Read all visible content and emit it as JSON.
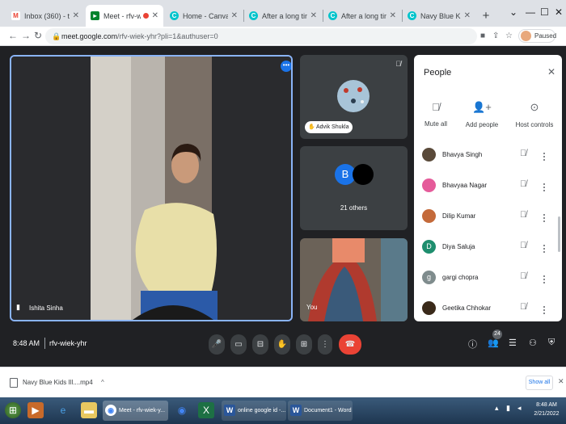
{
  "browser": {
    "tabs": [
      {
        "title": "Inbox (360) - tarannum",
        "favicon": "gmail-icon",
        "active": false
      },
      {
        "title": "Meet - rfv-wiek-yhr",
        "favicon": "meet-icon",
        "active": true,
        "recording": true
      },
      {
        "title": "Home - Canva",
        "favicon": "canva-icon",
        "active": false
      },
      {
        "title": "After a long time our st",
        "favicon": "canva-icon",
        "active": false
      },
      {
        "title": "After a long time our st",
        "favicon": "canva-icon",
        "active": false
      },
      {
        "title": "Navy Blue Kids Illustrat",
        "favicon": "canva-icon",
        "active": false
      }
    ],
    "new_tab_glyph": "+",
    "window": {
      "minimize": "⌄",
      "restore": "—",
      "maximize": "☐",
      "close": "✕"
    },
    "url_host": "meet.google.com",
    "url_path": "/rfv-wiek-yhr?pli=1&authuser=0",
    "profile_label": "Paused"
  },
  "meet": {
    "main_tile": {
      "name": "Ishita Sinha"
    },
    "tiles": [
      {
        "name": "Advik Shukla"
      },
      {
        "avatar_letter": "B",
        "others_label": "21 others"
      },
      {
        "name": "You"
      }
    ],
    "time": "8:48 AM",
    "meeting_code": "rfv-wiek-yhr",
    "participants_count": "24",
    "colors": {
      "accent": "#8ab4f8",
      "end_call": "#ea4335",
      "panel_bg": "#ffffff"
    }
  },
  "people_panel": {
    "title": "People",
    "actions": [
      {
        "label": "Mute all",
        "icon": "mic-off-icon"
      },
      {
        "label": "Add people",
        "icon": "add-person-icon"
      },
      {
        "label": "Host controls",
        "icon": "toggle-icon"
      }
    ],
    "participants": [
      {
        "name": "Bhavya Singh",
        "avatar": "",
        "color": "#5a4a3a"
      },
      {
        "name": "Bhavyaa Nagar",
        "avatar": "",
        "color": "#e55b9a"
      },
      {
        "name": "Dilip Kumar",
        "avatar": "",
        "color": "#c46a3a"
      },
      {
        "name": "Diya Saluja",
        "avatar": "D",
        "color": "#1e8e6e"
      },
      {
        "name": "gargi chopra",
        "avatar": "g",
        "color": "#7f8c8d"
      },
      {
        "name": "Geetika Chhokar",
        "avatar": "",
        "color": "#3a2a1a"
      }
    ]
  },
  "downloads": {
    "file": "Navy Blue Kids Ill....mp4",
    "show_all": "Show all"
  },
  "taskbar": {
    "items": [
      {
        "label": "Meet - rfv-wiek-y...",
        "icon": "chrome-icon",
        "color": "#4285f4"
      },
      {
        "label": "online google id -...",
        "icon": "word-icon",
        "color": "#2b579a"
      },
      {
        "label": "Document1 - Word",
        "icon": "word-icon",
        "color": "#2b579a"
      }
    ],
    "time": "8:48 AM",
    "date": "2/21/2022"
  }
}
